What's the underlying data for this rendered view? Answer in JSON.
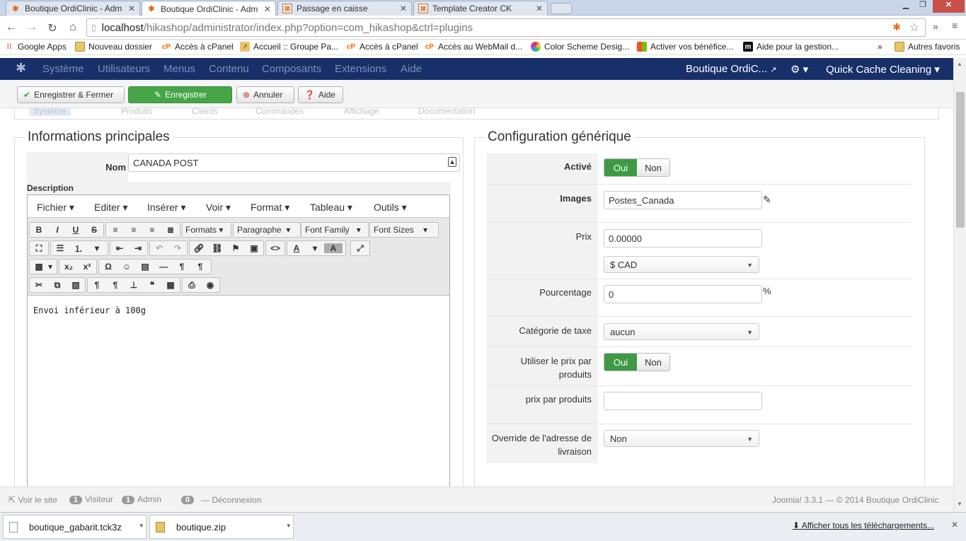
{
  "browser": {
    "tabs": [
      {
        "title": "Boutique OrdiClinic - Adm",
        "icon": "joomla-icon"
      },
      {
        "title": "Boutique OrdiClinic - Adm",
        "icon": "joomla-icon"
      },
      {
        "title": "Passage en caisse",
        "icon": "template-icon"
      },
      {
        "title": "Template Creator CK",
        "icon": "template-icon"
      }
    ],
    "url_host": "localhost",
    "url_rest": "/hikashop/administrator/index.php?option=com_hikashop&ctrl=plugins",
    "bookmarks": [
      {
        "label": "Google Apps",
        "icon": "apps-icon"
      },
      {
        "label": "Nouveau dossier",
        "icon": "folder-icon"
      },
      {
        "label": "Accès à cPanel",
        "icon": "cpanel-icon"
      },
      {
        "label": "Accueil :: Groupe Pa...",
        "icon": "chart-icon"
      },
      {
        "label": "Accès à cPanel",
        "icon": "cpanel-icon"
      },
      {
        "label": "Accès au WebMail d...",
        "icon": "cpanel-icon"
      },
      {
        "label": "Color Scheme Desig...",
        "icon": "color-icon"
      },
      {
        "label": "Activer vos bénéfice...",
        "icon": "windows-icon"
      },
      {
        "label": "Aide pour la gestion...",
        "icon": "m-icon"
      }
    ],
    "bookmarks_more": "»",
    "other_bookmarks": "Autres favoris"
  },
  "joomla_nav": {
    "items": [
      "Système",
      "Utilisateurs",
      "Menus",
      "Contenu",
      "Composants",
      "Extensions",
      "Aide"
    ],
    "site_name": "Boutique OrdiC...",
    "quick_cache": "Quick Cache Cleaning"
  },
  "toolbar": {
    "save_close": "Enregistrer & Fermer",
    "save": "Enregistrer",
    "cancel": "Annuler",
    "help": "Aide"
  },
  "submenu_ghost": [
    "Système",
    "Produits",
    "Clients",
    "Commandes",
    "Affichage",
    "Documentation"
  ],
  "main_info": {
    "legend": "Informations principales",
    "name_label": "Nom",
    "name_value": "CANADA POST",
    "description_label": "Description"
  },
  "editor": {
    "menus": [
      "Fichier",
      "Editer",
      "Insérer",
      "Voir",
      "Format",
      "Tableau",
      "Outils"
    ],
    "formats": "Formats",
    "paragraph": "Paragraphe",
    "font_family": "Font Family",
    "font_sizes": "Font Sizes",
    "content": "Envoi inférieur à 100g"
  },
  "generic_config": {
    "legend": "Configuration générique",
    "active_label": "Activé",
    "yes": "Oui",
    "no": "Non",
    "images_label": "Images",
    "images_value": "Postes_Canada",
    "price_label": "Prix",
    "price_value": "0.00000",
    "currency": "$ CAD",
    "percent_label": "Pourcentage",
    "percent_value": "0",
    "percent_sign": "%",
    "tax_label": "Catégorie de taxe",
    "tax_value": "aucun",
    "per_product_label": "Utiliser le prix par produits",
    "price_per_product_label": "prix par produits",
    "price_per_product_value": "",
    "override_label": "Override de l'adresse de livraison",
    "override_value": "Non"
  },
  "status": {
    "view_site": "Voir le site",
    "visitors_count": "1",
    "visitors": "Visiteur",
    "admin_count": "1",
    "admin": "Admin",
    "messages_count": "0",
    "logout": "Déconnexion",
    "version": "Joomla! 3.3.1 — © 2014 Boutique OrdiClinic"
  },
  "downloads": {
    "items": [
      "boutique_gabarit.tck3z",
      "boutique.zip"
    ],
    "show_all": "Afficher tous les téléchargements..."
  }
}
